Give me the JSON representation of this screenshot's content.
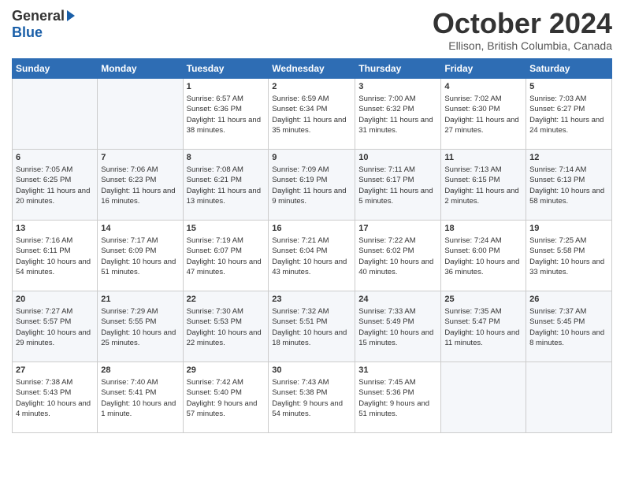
{
  "header": {
    "logo_general": "General",
    "logo_blue": "Blue",
    "month_title": "October 2024",
    "location": "Ellison, British Columbia, Canada"
  },
  "days_of_week": [
    "Sunday",
    "Monday",
    "Tuesday",
    "Wednesday",
    "Thursday",
    "Friday",
    "Saturday"
  ],
  "weeks": [
    [
      {
        "day": "",
        "content": ""
      },
      {
        "day": "",
        "content": ""
      },
      {
        "day": "1",
        "content": "Sunrise: 6:57 AM\nSunset: 6:36 PM\nDaylight: 11 hours and 38 minutes."
      },
      {
        "day": "2",
        "content": "Sunrise: 6:59 AM\nSunset: 6:34 PM\nDaylight: 11 hours and 35 minutes."
      },
      {
        "day": "3",
        "content": "Sunrise: 7:00 AM\nSunset: 6:32 PM\nDaylight: 11 hours and 31 minutes."
      },
      {
        "day": "4",
        "content": "Sunrise: 7:02 AM\nSunset: 6:30 PM\nDaylight: 11 hours and 27 minutes."
      },
      {
        "day": "5",
        "content": "Sunrise: 7:03 AM\nSunset: 6:27 PM\nDaylight: 11 hours and 24 minutes."
      }
    ],
    [
      {
        "day": "6",
        "content": "Sunrise: 7:05 AM\nSunset: 6:25 PM\nDaylight: 11 hours and 20 minutes."
      },
      {
        "day": "7",
        "content": "Sunrise: 7:06 AM\nSunset: 6:23 PM\nDaylight: 11 hours and 16 minutes."
      },
      {
        "day": "8",
        "content": "Sunrise: 7:08 AM\nSunset: 6:21 PM\nDaylight: 11 hours and 13 minutes."
      },
      {
        "day": "9",
        "content": "Sunrise: 7:09 AM\nSunset: 6:19 PM\nDaylight: 11 hours and 9 minutes."
      },
      {
        "day": "10",
        "content": "Sunrise: 7:11 AM\nSunset: 6:17 PM\nDaylight: 11 hours and 5 minutes."
      },
      {
        "day": "11",
        "content": "Sunrise: 7:13 AM\nSunset: 6:15 PM\nDaylight: 11 hours and 2 minutes."
      },
      {
        "day": "12",
        "content": "Sunrise: 7:14 AM\nSunset: 6:13 PM\nDaylight: 10 hours and 58 minutes."
      }
    ],
    [
      {
        "day": "13",
        "content": "Sunrise: 7:16 AM\nSunset: 6:11 PM\nDaylight: 10 hours and 54 minutes."
      },
      {
        "day": "14",
        "content": "Sunrise: 7:17 AM\nSunset: 6:09 PM\nDaylight: 10 hours and 51 minutes."
      },
      {
        "day": "15",
        "content": "Sunrise: 7:19 AM\nSunset: 6:07 PM\nDaylight: 10 hours and 47 minutes."
      },
      {
        "day": "16",
        "content": "Sunrise: 7:21 AM\nSunset: 6:04 PM\nDaylight: 10 hours and 43 minutes."
      },
      {
        "day": "17",
        "content": "Sunrise: 7:22 AM\nSunset: 6:02 PM\nDaylight: 10 hours and 40 minutes."
      },
      {
        "day": "18",
        "content": "Sunrise: 7:24 AM\nSunset: 6:00 PM\nDaylight: 10 hours and 36 minutes."
      },
      {
        "day": "19",
        "content": "Sunrise: 7:25 AM\nSunset: 5:58 PM\nDaylight: 10 hours and 33 minutes."
      }
    ],
    [
      {
        "day": "20",
        "content": "Sunrise: 7:27 AM\nSunset: 5:57 PM\nDaylight: 10 hours and 29 minutes."
      },
      {
        "day": "21",
        "content": "Sunrise: 7:29 AM\nSunset: 5:55 PM\nDaylight: 10 hours and 25 minutes."
      },
      {
        "day": "22",
        "content": "Sunrise: 7:30 AM\nSunset: 5:53 PM\nDaylight: 10 hours and 22 minutes."
      },
      {
        "day": "23",
        "content": "Sunrise: 7:32 AM\nSunset: 5:51 PM\nDaylight: 10 hours and 18 minutes."
      },
      {
        "day": "24",
        "content": "Sunrise: 7:33 AM\nSunset: 5:49 PM\nDaylight: 10 hours and 15 minutes."
      },
      {
        "day": "25",
        "content": "Sunrise: 7:35 AM\nSunset: 5:47 PM\nDaylight: 10 hours and 11 minutes."
      },
      {
        "day": "26",
        "content": "Sunrise: 7:37 AM\nSunset: 5:45 PM\nDaylight: 10 hours and 8 minutes."
      }
    ],
    [
      {
        "day": "27",
        "content": "Sunrise: 7:38 AM\nSunset: 5:43 PM\nDaylight: 10 hours and 4 minutes."
      },
      {
        "day": "28",
        "content": "Sunrise: 7:40 AM\nSunset: 5:41 PM\nDaylight: 10 hours and 1 minute."
      },
      {
        "day": "29",
        "content": "Sunrise: 7:42 AM\nSunset: 5:40 PM\nDaylight: 9 hours and 57 minutes."
      },
      {
        "day": "30",
        "content": "Sunrise: 7:43 AM\nSunset: 5:38 PM\nDaylight: 9 hours and 54 minutes."
      },
      {
        "day": "31",
        "content": "Sunrise: 7:45 AM\nSunset: 5:36 PM\nDaylight: 9 hours and 51 minutes."
      },
      {
        "day": "",
        "content": ""
      },
      {
        "day": "",
        "content": ""
      }
    ]
  ]
}
